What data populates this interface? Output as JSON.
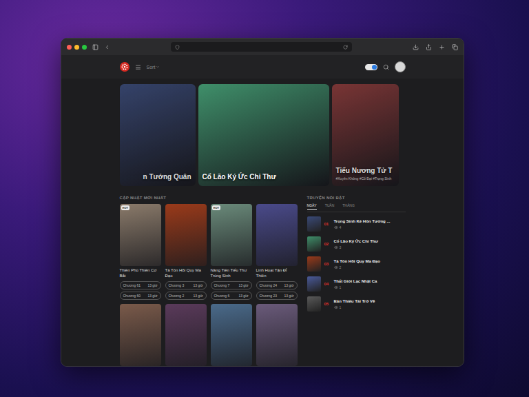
{
  "browser": {
    "url": ""
  },
  "header": {
    "menu_label": "Sort",
    "theme_toggle": {
      "on": true
    }
  },
  "hero": [
    {
      "title": "n Tướng Quân",
      "tags": "",
      "color": "#3a4a78",
      "selected": false
    },
    {
      "title": "Cổ Lão Ký Ức Chi Thư",
      "tags": "",
      "color": "#3f8f6a",
      "selected": true
    },
    {
      "title": "Tiểu Nương Tử T",
      "tags": "#Xuyên Không #Cổ Đại #Trọng Sinh",
      "color": "#8a3a3a",
      "selected": false
    }
  ],
  "latest": {
    "title": "CẬP NHẬT MỚI NHẤT",
    "cards": [
      {
        "title": "Thiên Phú Thiên Cơ Bắt",
        "badge": "HOT",
        "color": "#8a7a6a",
        "chapters": [
          {
            "label": "Chương 61",
            "time": "13 giờ"
          },
          {
            "label": "Chương 60",
            "time": "13 giờ"
          }
        ]
      },
      {
        "title": "Tà Tôn Hồi Quy Ma Đạo",
        "badge": "",
        "color": "#9a3a1a",
        "chapters": [
          {
            "label": "Chương 3",
            "time": "13 giờ"
          },
          {
            "label": "Chương 2",
            "time": "13 giờ"
          }
        ]
      },
      {
        "title": "Nàng Tiên Tiểu Thư Trùng Sinh",
        "badge": "HOT",
        "color": "#6a8a7a",
        "chapters": [
          {
            "label": "Chương 7",
            "time": "13 giờ"
          },
          {
            "label": "Chương 6",
            "time": "13 giờ"
          }
        ]
      },
      {
        "title": "Linh Hoạt Tận Đỉ Thiên",
        "badge": "",
        "color": "#4a4a8a",
        "chapters": [
          {
            "label": "Chương 24",
            "time": "13 giờ"
          },
          {
            "label": "Chương 23",
            "time": "13 giờ"
          }
        ]
      }
    ],
    "next_row": [
      {
        "color": "#7a5a4a"
      },
      {
        "color": "#5a3a5a"
      },
      {
        "color": "#4a6a8a"
      },
      {
        "color": "#6a5a7a"
      }
    ]
  },
  "featured": {
    "title": "TRUYỆN NỔI BẬT",
    "tabs": [
      {
        "label": "NGÀY",
        "selected": true
      },
      {
        "label": "TUẦN",
        "selected": false
      },
      {
        "label": "THÁNG",
        "selected": false
      }
    ],
    "items": [
      {
        "rank": "01",
        "title": "Trọng Sinh Kẻ Hôn Tướng ...",
        "views": "4",
        "color": "#3a4a78"
      },
      {
        "rank": "02",
        "title": "Cổ Lão Ký Ức Chi Thư",
        "views": "3",
        "color": "#3f8f6a"
      },
      {
        "rank": "03",
        "title": "Tà Tôn Hồi Quy Ma Đạo",
        "views": "2",
        "color": "#9a3a1a"
      },
      {
        "rank": "04",
        "title": "Thất Giới Lạc Nhật Ca",
        "views": "1",
        "color": "#4a5a9a"
      },
      {
        "rank": "05",
        "title": "Bán Thiêu Tái Trở Về",
        "views": "1",
        "color": "#5a5a5a"
      }
    ]
  }
}
